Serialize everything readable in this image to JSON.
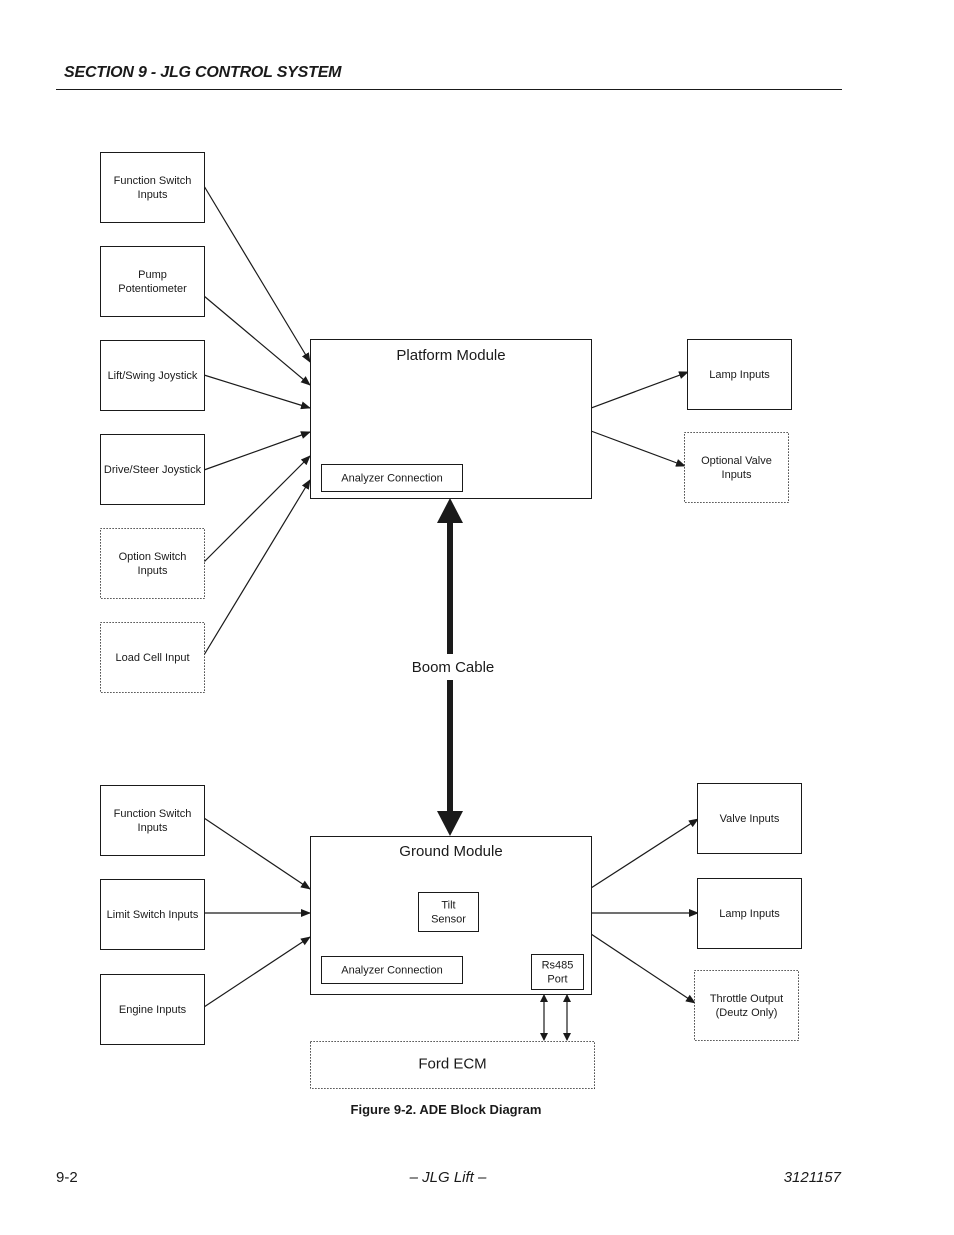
{
  "header": {
    "section_title": "SECTION 9 - JLG CONTROL SYSTEM"
  },
  "diagram": {
    "platform_inputs": [
      {
        "id": "function-switch-inputs",
        "lines": [
          "Function Switch",
          "Inputs"
        ],
        "style": "solid"
      },
      {
        "id": "pump-potentiometer",
        "lines": [
          "Pump",
          "Potentiometer"
        ],
        "style": "solid"
      },
      {
        "id": "lift-swing-joystick",
        "lines": [
          "Lift/Swing Joystick"
        ],
        "style": "solid"
      },
      {
        "id": "drive-steer-joystick",
        "lines": [
          "Drive/Steer Joystick"
        ],
        "style": "solid"
      },
      {
        "id": "option-switch-inputs",
        "lines": [
          "Option Switch",
          "Inputs"
        ],
        "style": "dotted"
      },
      {
        "id": "load-cell-input",
        "lines": [
          "Load Cell Input"
        ],
        "style": "dotted"
      }
    ],
    "platform_module": {
      "title": "Platform Module",
      "analyzer": "Analyzer Connection"
    },
    "platform_outputs": [
      {
        "id": "lamp-inputs",
        "lines": [
          "Lamp Inputs"
        ],
        "style": "solid"
      },
      {
        "id": "optional-valve-inputs",
        "lines": [
          "Optional Valve",
          "Inputs"
        ],
        "style": "dotted"
      }
    ],
    "boom_cable": "Boom Cable",
    "ground_inputs": [
      {
        "id": "function-switch-inputs",
        "lines": [
          "Function Switch",
          "Inputs"
        ],
        "style": "solid"
      },
      {
        "id": "limit-switch-inputs",
        "lines": [
          "Limit Switch Inputs"
        ],
        "style": "solid"
      },
      {
        "id": "engine-inputs",
        "lines": [
          "Engine Inputs"
        ],
        "style": "solid"
      }
    ],
    "ground_module": {
      "title": "Ground Module",
      "tilt_sensor": [
        "Tilt",
        "Sensor"
      ],
      "analyzer": "Analyzer Connection",
      "rs485": [
        "Rs485",
        "Port"
      ]
    },
    "ground_outputs": [
      {
        "id": "valve-inputs",
        "lines": [
          "Valve Inputs"
        ],
        "style": "solid"
      },
      {
        "id": "lamp-inputs",
        "lines": [
          "Lamp Inputs"
        ],
        "style": "solid"
      },
      {
        "id": "throttle-output",
        "lines": [
          "Throttle Output",
          "(Deutz Only)"
        ],
        "style": "dotted"
      }
    ],
    "ecm": {
      "label": "Ford ECM",
      "style": "dotted"
    }
  },
  "caption": "Figure 9-2.  ADE Block Diagram",
  "footer": {
    "page": "9-2",
    "center": "– JLG Lift –",
    "doc_number": "3121157"
  }
}
